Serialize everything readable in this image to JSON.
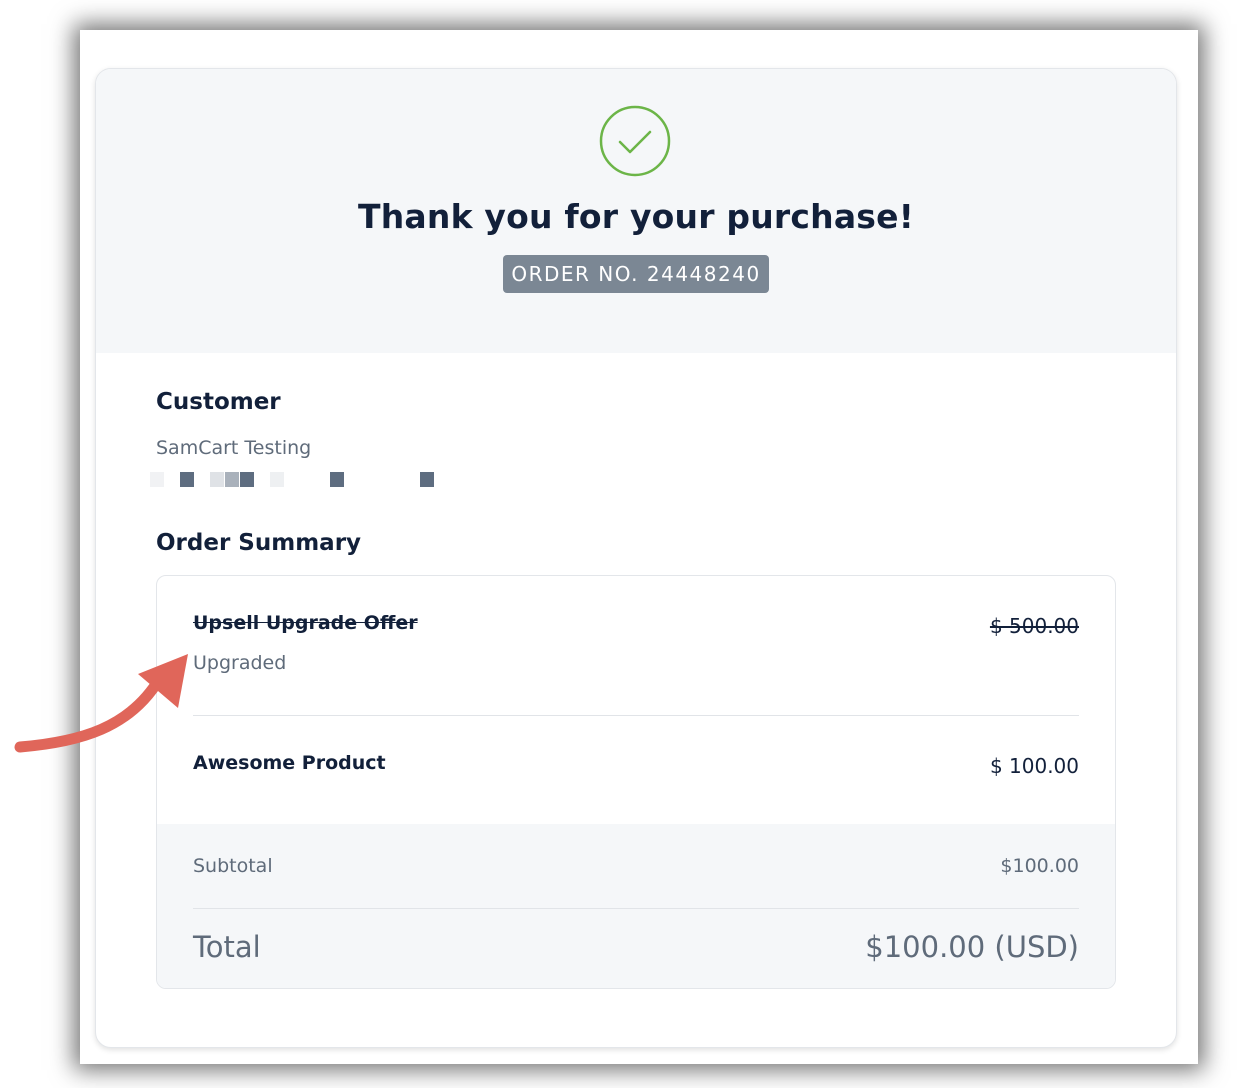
{
  "header": {
    "title": "Thank you for your purchase!",
    "order_badge": "ORDER NO. 24448240"
  },
  "customer": {
    "heading": "Customer",
    "name": "SamCart Testing"
  },
  "order_summary": {
    "heading": "Order Summary",
    "items": [
      {
        "name": "Upsell Upgrade Offer",
        "price": "$ 500.00",
        "note": "Upgraded",
        "struck_through": true
      },
      {
        "name": "Awesome Product",
        "price": "$ 100.00",
        "struck_through": false
      }
    ],
    "subtotal_label": "Subtotal",
    "subtotal_value": "$100.00",
    "total_label": "Total",
    "total_value": "$100.00 (USD)"
  },
  "colors": {
    "success_green": "#6cb548",
    "badge_gray": "#7b8794",
    "heading_navy": "#12203a",
    "annotation_arrow": "#e0665a"
  },
  "icons": {
    "success": "check-circle-icon",
    "annotation": "annotation-arrow-icon"
  }
}
